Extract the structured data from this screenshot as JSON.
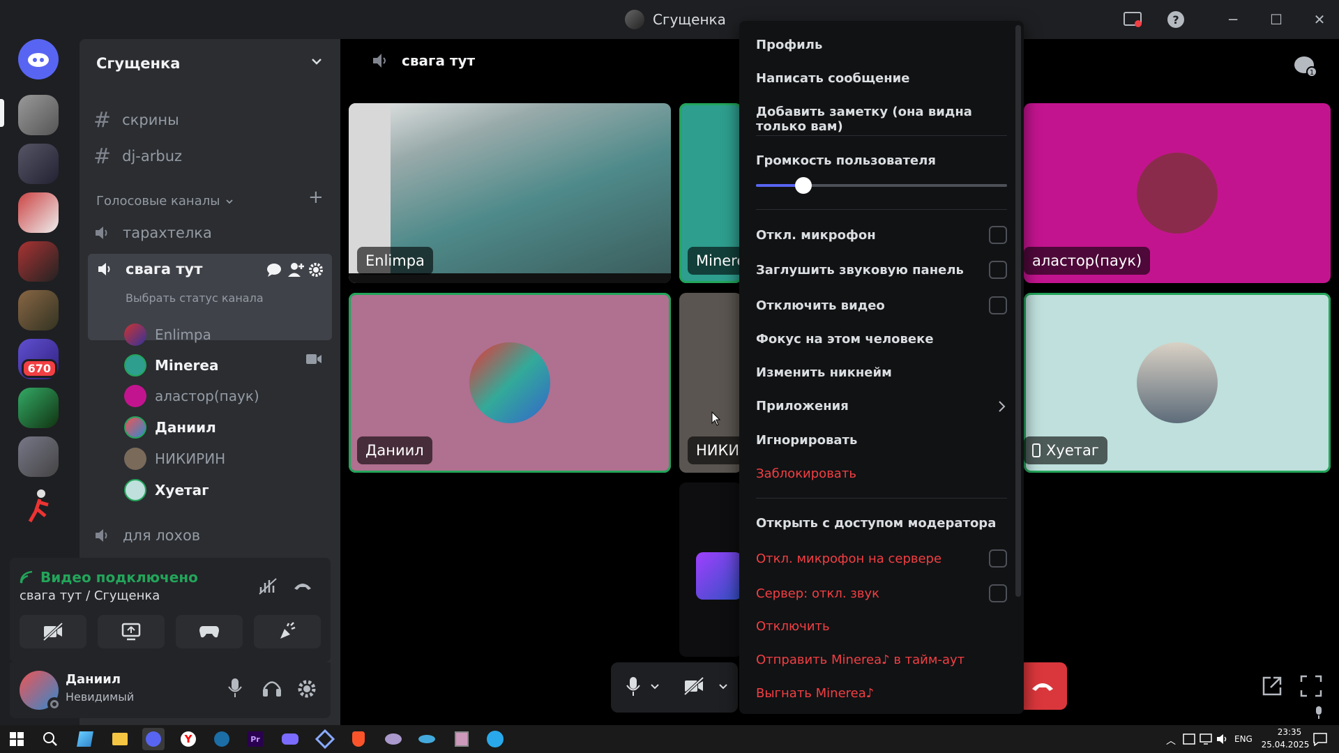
{
  "window": {
    "title": "Сгущенка"
  },
  "servers": {
    "badge": "670"
  },
  "sidebar": {
    "guild_name": "Сгущенка",
    "text_channels": [
      "скрины",
      "dj-arbuz"
    ],
    "voice_category": "Голосовые каналы",
    "voice_channels": {
      "first": "тарахтелка",
      "active": "свага тут",
      "last": "для лохов"
    },
    "active_status": "Выбрать статус канала",
    "members": [
      "Enlimpa",
      "Minerea",
      "аластор(паук)",
      "Даниил",
      "НИКИРИН",
      "Хуетаг"
    ]
  },
  "voice_panel": {
    "status": "Видео подключено",
    "location": "свага тут / Сгущенка"
  },
  "user_panel": {
    "name": "Даниил",
    "status": "Невидимый"
  },
  "main": {
    "channel_title": "свага тут",
    "tiles": [
      {
        "label": "Enlimpa"
      },
      {
        "label": "Minere"
      },
      {
        "label": "аластор(паук)"
      },
      {
        "label": "Даниил"
      },
      {
        "label": "НИКИР"
      },
      {
        "label": "Хуетаг"
      }
    ]
  },
  "context_menu": {
    "profile": "Профиль",
    "message": "Написать сообщение",
    "add_note": "Добавить заметку (она видна только вам)",
    "user_volume": "Громкость пользователя",
    "user_volume_fraction": 0.19,
    "mute_mic": "Откл. микрофон",
    "mute_soundboard": "Заглушить звуковую панель",
    "disable_video": "Отключить видео",
    "focus": "Фокус на этом человеке",
    "change_nick": "Изменить никнейм",
    "apps": "Приложения",
    "ignore": "Игнорировать",
    "block": "Заблокировать",
    "open_mod": "Открыть с доступом модератора",
    "server_mute": "Откл. микрофон на сервере",
    "server_deafen": "Сервер: откл. звук",
    "disconnect": "Отключить",
    "timeout": "Отправить Minerea♪ в тайм-аут",
    "kick": "Выгнать Minerea♪"
  },
  "taskbar": {
    "lang": "ENG",
    "time": "23:35",
    "date": "25.04.2025"
  },
  "colors": {
    "accent": "#5865f2",
    "danger": "#f23f43",
    "online": "#23a55a"
  }
}
